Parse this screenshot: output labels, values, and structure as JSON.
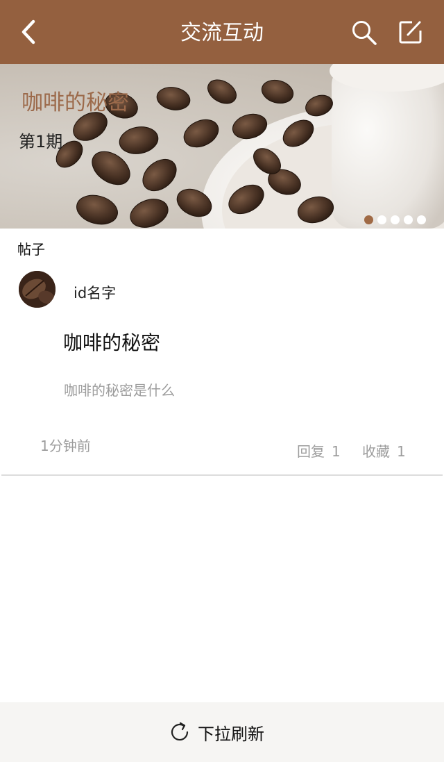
{
  "header": {
    "title": "交流互动",
    "back_icon": "chevron-left-icon",
    "search_icon": "search-icon",
    "edit_icon": "edit-icon",
    "background": "#94603f"
  },
  "banner": {
    "title": "咖啡的秘密",
    "issue": "第1期",
    "slides_count": 5,
    "active_slide": 1
  },
  "section": {
    "label": "帖子"
  },
  "post": {
    "username": "id名字",
    "title": "咖啡的秘密",
    "excerpt": "咖啡的秘密是什么",
    "time": "1分钟前",
    "reply_label": "回复",
    "reply_count": "1",
    "fav_label": "收藏",
    "fav_count": "1"
  },
  "footer": {
    "refresh_label": "下拉刷新",
    "refresh_icon": "refresh-icon"
  },
  "colors": {
    "accent": "#94603f",
    "dot_active": "#a06a45",
    "muted_text": "#9d9d9d"
  }
}
